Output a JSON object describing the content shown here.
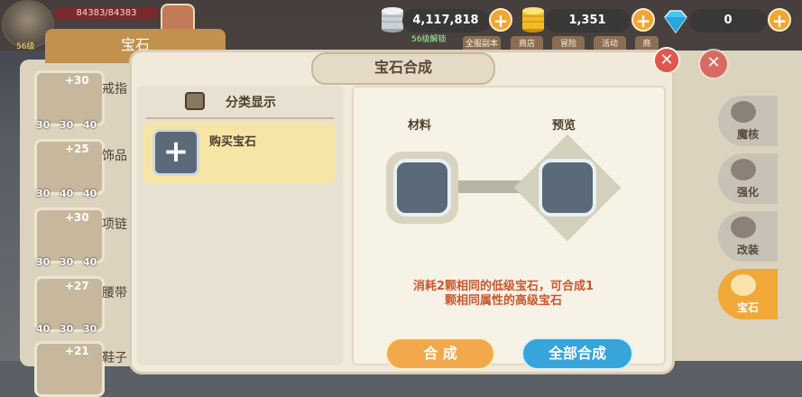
{
  "player": {
    "hp_text": "84383/84383",
    "level_text": "56级"
  },
  "currency": {
    "silver": "4,117,818",
    "gold": "1,351",
    "diamond": "0"
  },
  "background": {
    "hint": "56级解锁",
    "menu": [
      "全服副本",
      "商店",
      "冒险",
      "活动",
      "商"
    ],
    "left_title": "宝石",
    "slots": [
      {
        "plus": "+30",
        "name": "戒指",
        "nums": [
          "30",
          "30",
          "40"
        ]
      },
      {
        "plus": "+25",
        "name": "饰品",
        "nums": [
          "30",
          "40",
          "40"
        ]
      },
      {
        "plus": "+30",
        "name": "项链",
        "nums": [
          "30",
          "30",
          "40"
        ]
      },
      {
        "plus": "+27",
        "name": "腰带",
        "nums": [
          "40",
          "30",
          "30"
        ]
      },
      {
        "plus": "+21",
        "name": "鞋子",
        "nums": [
          "",
          "",
          ""
        ]
      }
    ],
    "side_tabs": [
      "魔核",
      "强化",
      "改装",
      "宝石"
    ]
  },
  "modal": {
    "title": "宝石合成",
    "category_label": "分类显示",
    "buy_label": "购买宝石",
    "material_label": "材料",
    "preview_label": "预览",
    "desc_line1": "消耗2颗相同的低级宝石，可合成1",
    "desc_line2": "颗相同属性的高级宝石",
    "compose_button": "合 成",
    "compose_all_button": "全部合成"
  },
  "colors": {
    "accent_orange": "#f2a94c",
    "accent_blue": "#37a4dc",
    "close_red": "#e0574e",
    "desc_red": "#c9572f",
    "panel_bg": "#f1eada"
  },
  "icons": [
    "silver-coin-icon",
    "gold-coin-icon",
    "diamond-icon",
    "plus-icon",
    "close-icon",
    "gem-slot-icon"
  ]
}
